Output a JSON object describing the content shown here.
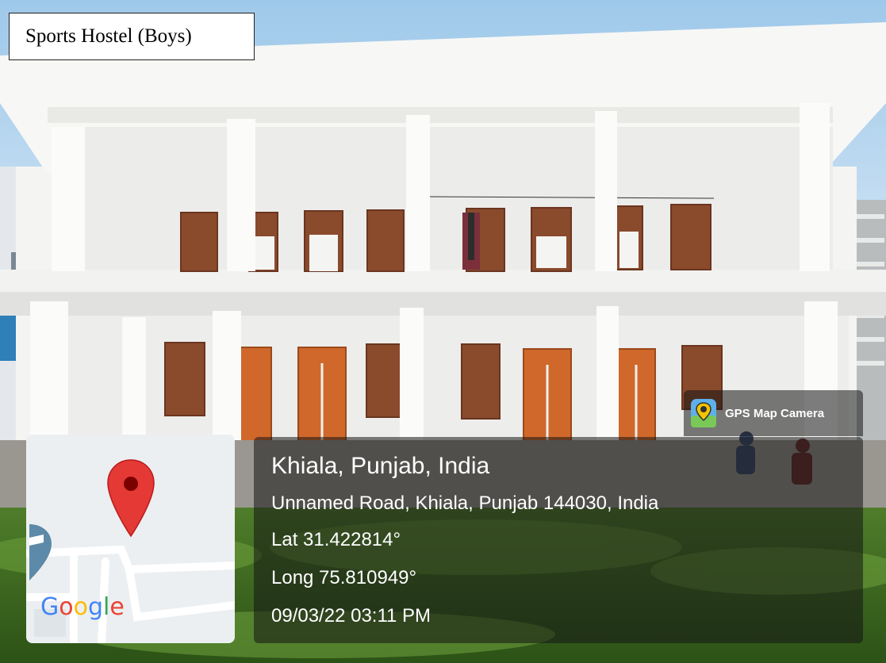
{
  "caption": "Sports Hostel (Boys)",
  "badge": {
    "label": "GPS Map Camera",
    "icon": "gps-map-camera-icon"
  },
  "location": {
    "title": "Khiala, Punjab, India",
    "address": "Unnamed Road, Khiala, Punjab 144030, India",
    "latitude": "Lat 31.422814°",
    "longitude": "Long 75.810949°",
    "datetime": "09/03/22 03:11 PM"
  },
  "map": {
    "logo": "Google",
    "logo_letters": [
      "G",
      "o",
      "o",
      "g",
      "l",
      "e"
    ],
    "logo_colors": [
      "#4285F4",
      "#EA4335",
      "#FBBC05",
      "#4285F4",
      "#34A853",
      "#EA4335"
    ],
    "pin_color": "#E53935"
  }
}
